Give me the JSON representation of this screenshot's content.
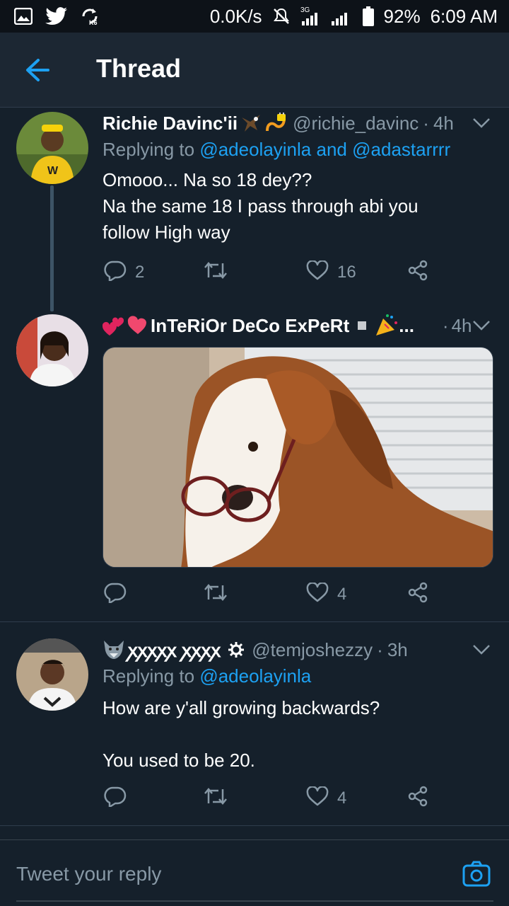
{
  "status_bar": {
    "speed": "0.0K/s",
    "network": "3G",
    "battery": "92%",
    "time": "6:09 AM"
  },
  "header": {
    "title": "Thread"
  },
  "tweets": [
    {
      "name": "Richie Davinc'ii",
      "handle": "@richie_davinc",
      "dot": "·",
      "time": "4h",
      "replying_prefix": "Replying to",
      "mention1": "@adeolayinla",
      "and_text": "and",
      "mention2": "@adastarrrr",
      "text_line1": "Omooo... Na so 18 dey??",
      "text_line2": "Na the same 18 I pass through abi you",
      "text_line3": "follow High way",
      "replies": "2",
      "retweets": "",
      "likes": "16"
    },
    {
      "name": "InTeRiOr DeCo ExPeRt",
      "name_suffix": "...",
      "dot": "·",
      "time": "4h",
      "replies": "",
      "retweets": "",
      "likes": "4"
    },
    {
      "name": "ꭗꭗꭗꭗꭗ ꭗꭗꭗꭗ",
      "handle": "@temjoshezzy",
      "dot": "·",
      "time": "3h",
      "replying_prefix": "Replying to",
      "mention1": "@adeolayinla",
      "text_line1": "How are y'all growing backwards?",
      "text_line2": "You used to be 20.",
      "replies": "",
      "retweets": "",
      "likes": "4"
    }
  ],
  "reply": {
    "placeholder": "Tweet your reply"
  },
  "colors": {
    "background": "#15202b",
    "accent": "#1da1f2",
    "muted": "#8899a6"
  },
  "icons": [
    "gallery-icon",
    "twitter-bird-icon",
    "sync-icon",
    "mute-icon",
    "signal-icon",
    "battery-icon",
    "back-arrow-icon",
    "chevron-down-icon",
    "reply-icon",
    "retweet-icon",
    "like-icon",
    "share-icon",
    "camera-icon"
  ]
}
